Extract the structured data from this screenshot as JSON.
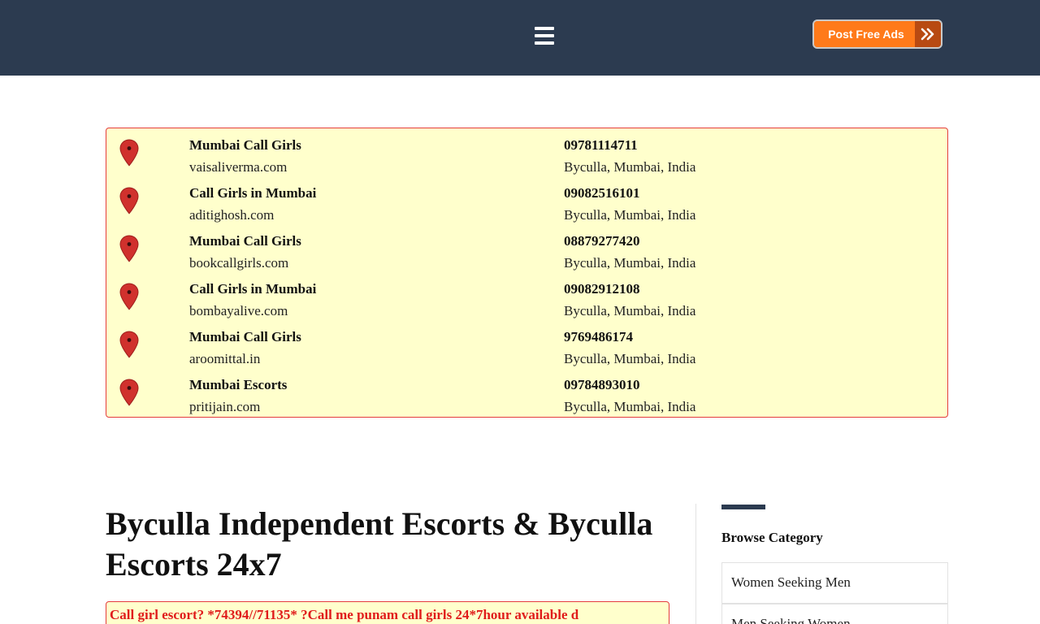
{
  "header": {
    "menu_icon": "hamburger-menu-icon",
    "post_button_label": "Post Free Ads",
    "post_button_icon": "double-chevron-right-icon",
    "colors": {
      "bar": "#2c3b50",
      "button": "#ff7a1a",
      "button_arrow_bg": "#b84a12"
    }
  },
  "listings": [
    {
      "name": "Mumbai Call Girls",
      "site": "vaisaliverma.com",
      "phone": "09781114711",
      "location": "Byculla, Mumbai, India"
    },
    {
      "name": "Call Girls in Mumbai",
      "site": "aditighosh.com",
      "phone": "09082516101",
      "location": "Byculla, Mumbai, India"
    },
    {
      "name": "Mumbai Call Girls",
      "site": "bookcallgirls.com",
      "phone": "08879277420",
      "location": "Byculla, Mumbai, India"
    },
    {
      "name": "Call Girls in Mumbai",
      "site": "bombayalive.com",
      "phone": "09082912108",
      "location": "Byculla, Mumbai, India"
    },
    {
      "name": "Mumbai Call Girls",
      "site": "aroomittal.in",
      "phone": "9769486174",
      "location": "Byculla, Mumbai, India"
    },
    {
      "name": "Mumbai Escorts",
      "site": "pritijain.com",
      "phone": "09784893010",
      "location": "Byculla, Mumbai, India"
    }
  ],
  "main": {
    "title": "Byculla Independent Escorts & Byculla Escorts 24x7",
    "first_ad_text": "Call girl escort? *74394//71135* ?Call me punam call girls 24*7hour available d"
  },
  "sidebar": {
    "title": "Browse Category",
    "categories": [
      "Women Seeking Men",
      "Men Seeking Women"
    ]
  },
  "colors": {
    "highlight_bg": "#ffffcc",
    "highlight_border": "#e43c3c",
    "pin": "#d0312d",
    "ad_text": "#e01b1b"
  }
}
